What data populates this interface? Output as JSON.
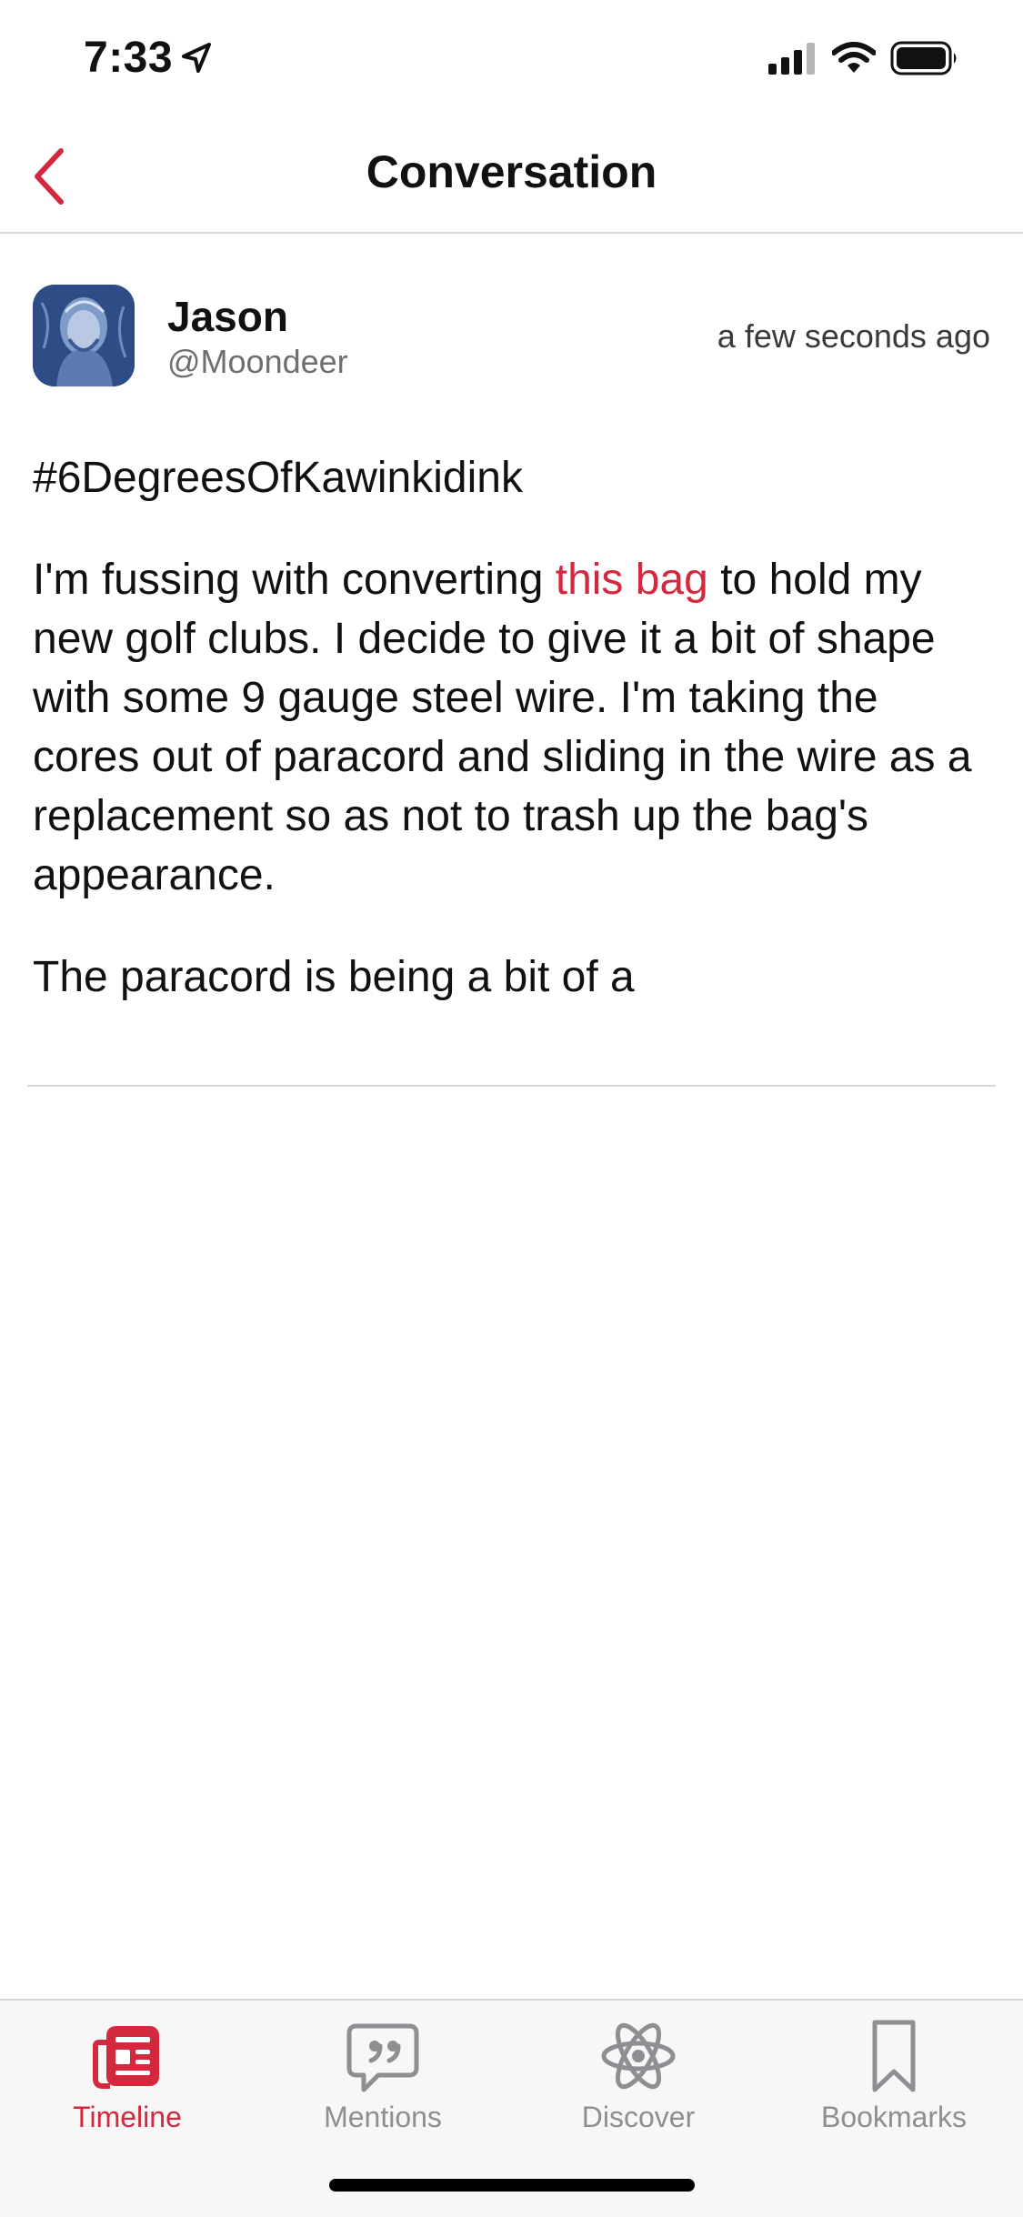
{
  "status_bar": {
    "time": "7:33"
  },
  "nav": {
    "title": "Conversation"
  },
  "post": {
    "author_name": "Jason",
    "author_handle": "@Moondeer",
    "timestamp": "a few seconds ago",
    "hashtag_line": "#6DegreesOfKawinkidink",
    "paragraph_1_before_link": "I'm fussing with converting ",
    "paragraph_1_link": "this bag",
    "paragraph_1_after_link": " to hold my new golf clubs. I decide to give it a bit of shape with some 9 gauge steel wire. I'm taking the cores out of paracord and sliding in the wire as a replacement so as not to trash up the bag's appearance.",
    "paragraph_2": "The paracord is being a bit of a"
  },
  "tab_bar": {
    "tabs": [
      {
        "label": "Timeline",
        "icon": "timeline-icon",
        "active": true
      },
      {
        "label": "Mentions",
        "icon": "mentions-icon",
        "active": false
      },
      {
        "label": "Discover",
        "icon": "discover-icon",
        "active": false
      },
      {
        "label": "Bookmarks",
        "icon": "bookmarks-icon",
        "active": false
      }
    ]
  },
  "colors": {
    "accent": "#d4283f",
    "inactive": "#8e8e93",
    "divider": "#d6d6d9",
    "tab_bar_bg": "#f7f7f7"
  }
}
